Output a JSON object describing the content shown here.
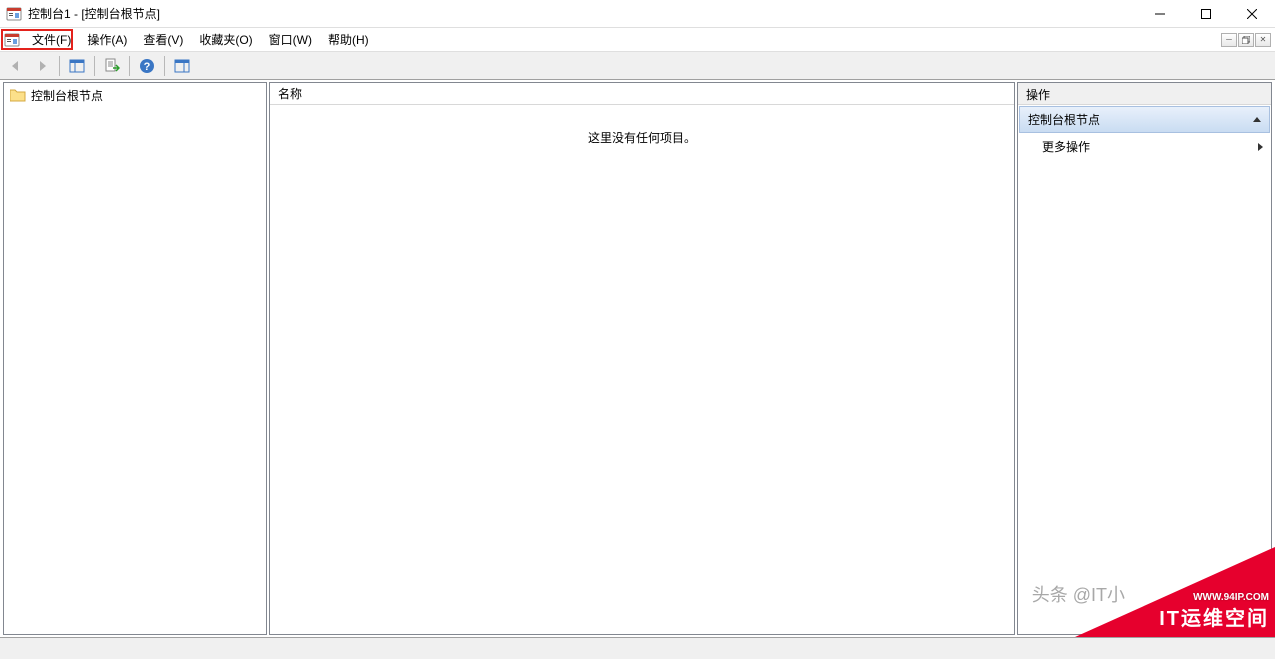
{
  "window": {
    "title": "控制台1 - [控制台根节点]"
  },
  "menu": {
    "file": "文件(F)",
    "action": "操作(A)",
    "view": "查看(V)",
    "favorites": "收藏夹(O)",
    "window": "窗口(W)",
    "help": "帮助(H)"
  },
  "tree": {
    "root": "控制台根节点"
  },
  "list": {
    "col_name": "名称",
    "empty": "这里没有任何项目。"
  },
  "actions": {
    "title": "操作",
    "section": "控制台根节点",
    "more": "更多操作"
  },
  "watermark": {
    "toutiao": "头条 @IT小",
    "url": "WWW.94IP.COM",
    "main": "IT运维空间"
  }
}
